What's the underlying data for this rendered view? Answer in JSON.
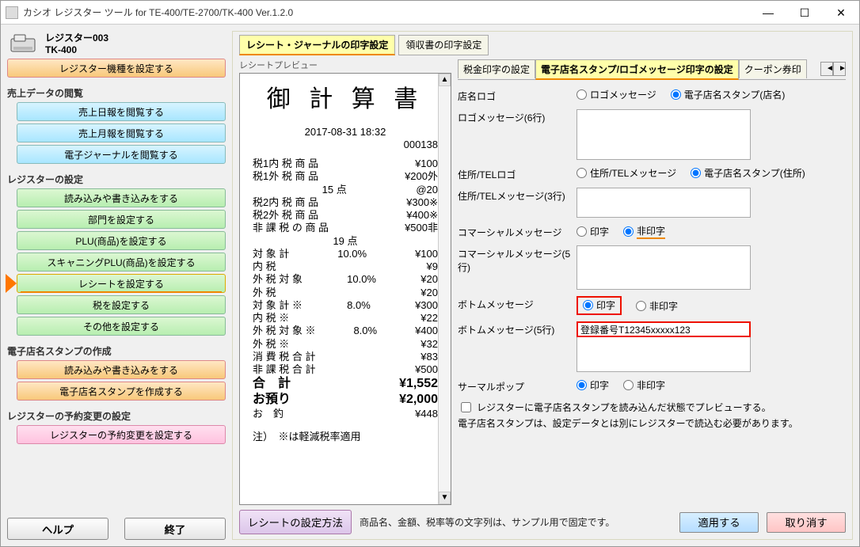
{
  "window": {
    "title": "カシオ レジスター ツール for TE-400/TE-2700/TK-400 Ver.1.2.0"
  },
  "register": {
    "name": "レジスター003",
    "model": "TK-400"
  },
  "left": {
    "setModel": "レジスター機種を設定する",
    "salesHeader": "売上データの閲覧",
    "salesDaily": "売上日報を閲覧する",
    "salesMonthly": "売上月報を閲覧する",
    "ejournal": "電子ジャーナルを閲覧する",
    "regSettingsHeader": "レジスターの設定",
    "readWrite": "読み込みや書き込みをする",
    "dept": "部門を設定する",
    "plu": "PLU(商品)を設定する",
    "scanPlu": "スキャニングPLU(商品)を設定する",
    "receipt": "レシートを設定する",
    "tax": "税を設定する",
    "other": "その他を設定する",
    "stampHeader": "電子店名スタンプの作成",
    "stampRW": "読み込みや書き込みをする",
    "stampCreate": "電子店名スタンプを作成する",
    "reserveHeader": "レジスターの予約変更の設定",
    "reserve": "レジスターの予約変更を設定する",
    "help": "ヘルプ",
    "exit": "終了"
  },
  "tabs": {
    "receiptJournal": "レシート・ジャーナルの印字設定",
    "receiptBook": "領収書の印字設定"
  },
  "preview": {
    "label": "レシートプレビュー",
    "title": "御 計 算 書",
    "datetime": "2017-08-31 18:32",
    "serial": "000138",
    "lines": [
      [
        "税1内 税 商 品",
        "",
        "¥100"
      ],
      [
        "税1外 税 商 品",
        "",
        "¥200外"
      ],
      [
        "",
        "15 点",
        "@20"
      ],
      [
        "税2内 税 商 品",
        "",
        "¥300※"
      ],
      [
        "税2外 税 商 品",
        "",
        "¥400※"
      ],
      [
        "非 課 税 の 商 品",
        "",
        "¥500非"
      ]
    ],
    "pts": "19 点",
    "lines2": [
      [
        "対 象 計",
        "10.0%",
        "¥100"
      ],
      [
        "内 税",
        "",
        "¥9"
      ],
      [
        "外 税 対 象",
        "10.0%",
        "¥20"
      ],
      [
        "外 税",
        "",
        "¥20"
      ],
      [
        "対 象 計 ※",
        "8.0%",
        "¥300"
      ],
      [
        "内 税 ※",
        "",
        "¥22"
      ],
      [
        "外 税 対 象 ※",
        "8.0%",
        "¥400"
      ],
      [
        "外 税 ※",
        "",
        "¥32"
      ],
      [
        "消 費 税 合 計",
        "",
        "¥83"
      ],
      [
        "非 課 税 合 計",
        "",
        "¥500"
      ]
    ],
    "totals": [
      [
        "合　計",
        "¥1,552"
      ],
      [
        "お預り",
        "¥2,000"
      ],
      [
        "お　釣",
        "¥448"
      ]
    ],
    "footnote": "注）　※は軽減税率適用"
  },
  "subtabs": {
    "tax": "税金印字の設定",
    "stampLogo": "電子店名スタンプ/ロゴメッセージ印字の設定",
    "coupon": "クーポン券印"
  },
  "form": {
    "storeLogo": "店名ロゴ",
    "storeLogoOpt1": "ロゴメッセージ",
    "storeLogoOpt2": "電子店名スタンプ(店名)",
    "logoMsg": "ロゴメッセージ(6行)",
    "addrLogo": "住所/TELロゴ",
    "addrOpt1": "住所/TELメッセージ",
    "addrOpt2": "電子店名スタンプ(住所)",
    "addrMsg": "住所/TELメッセージ(3行)",
    "commercial": "コマーシャルメッセージ",
    "print": "印字",
    "noPrint": "非印字",
    "commercialMsg": "コマーシャルメッセージ(5行)",
    "bottomMsg": "ボトムメッセージ",
    "bottomMsgLines": "ボトムメッセージ(5行)",
    "bottomValue": "登録番号T12345xxxxx123",
    "thermalPop": "サーマルポップ",
    "previewCheck": "レジスターに電子店名スタンプを読み込んだ状態でプレビューする。",
    "stampNote": "電子店名スタンプは、設定データとは別にレジスターで読込む必要があります。"
  },
  "bottom": {
    "method": "レシートの設定方法",
    "fixedNote": "商品名、金額、税率等の文字列は、サンプル用で固定です。",
    "apply": "適用する",
    "cancel": "取り消す"
  }
}
